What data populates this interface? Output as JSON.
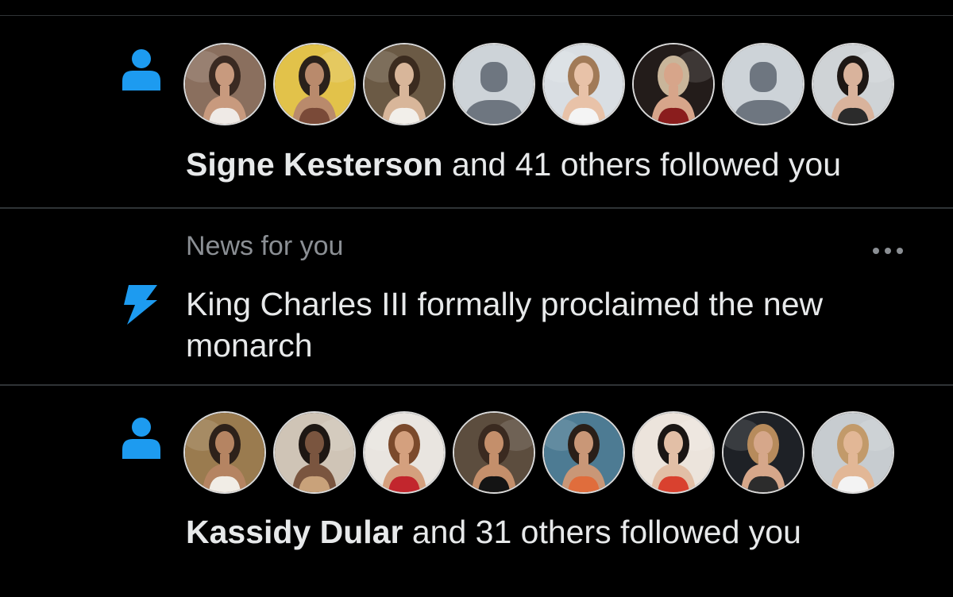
{
  "colors": {
    "background": "#000000",
    "accent": "#1d9bf0",
    "divider": "#2f3336",
    "text_primary": "#e7e9ea",
    "text_secondary": "#8b8f94"
  },
  "notifications": [
    {
      "type": "follow",
      "icon": "person-icon",
      "text": {
        "name": "Signe Kesterson",
        "rest": " and 41 others followed you"
      },
      "avatars": [
        {
          "kind": "photo",
          "bg": "#8a6f5e",
          "skin": "#c89a7e",
          "hair": "#3a2a22",
          "outfit": "#efeae6"
        },
        {
          "kind": "photo",
          "bg": "#e2c24a",
          "skin": "#b98a6c",
          "hair": "#2a211b",
          "outfit": "#7a4a38"
        },
        {
          "kind": "photo",
          "bg": "#6b5a45",
          "skin": "#d8b69a",
          "hair": "#3b2b1f",
          "outfit": "#f2efea"
        },
        {
          "kind": "default"
        },
        {
          "kind": "photo",
          "bg": "#d9dee3",
          "skin": "#e8c2a8",
          "hair": "#a17a57",
          "outfit": "#f4f4f4"
        },
        {
          "kind": "photo",
          "bg": "#231c1a",
          "skin": "#d7a58a",
          "hair": "#c9b59a",
          "outfit": "#8a1d1d"
        },
        {
          "kind": "default"
        },
        {
          "kind": "photo",
          "bg": "#cfd3d6",
          "skin": "#d9b39c",
          "hair": "#1d1714",
          "outfit": "#2b2b2b"
        }
      ]
    },
    {
      "type": "news",
      "icon": "lightning-icon",
      "context": "News for you",
      "headline": "King Charles III formally proclaimed the new monarch",
      "more_icon": "more-dots-icon"
    },
    {
      "type": "follow",
      "icon": "person-icon",
      "text": {
        "name": "Kassidy Dular",
        "rest": " and 31 others followed you"
      },
      "avatars": [
        {
          "kind": "photo",
          "bg": "#9a7b4f",
          "skin": "#b58462",
          "hair": "#2d211a",
          "outfit": "#f1ede6"
        },
        {
          "kind": "photo",
          "bg": "#cfc4b6",
          "skin": "#7a553f",
          "hair": "#1e1713",
          "outfit": "#c9a27a"
        },
        {
          "kind": "photo",
          "bg": "#e9e5e0",
          "skin": "#d4a07e",
          "hair": "#7b4a2c",
          "outfit": "#c2262d"
        },
        {
          "kind": "photo",
          "bg": "#5c4d3e",
          "skin": "#c48f6b",
          "hair": "#3a2a20",
          "outfit": "#141414"
        },
        {
          "kind": "photo",
          "bg": "#4d7b93",
          "skin": "#c99777",
          "hair": "#2a1f18",
          "outfit": "#e06d3c"
        },
        {
          "kind": "photo",
          "bg": "#ece4dc",
          "skin": "#e2bfa6",
          "hair": "#1a1614",
          "outfit": "#d9412f"
        },
        {
          "kind": "photo",
          "bg": "#1e2126",
          "skin": "#d6a78a",
          "hair": "#b78b5c",
          "outfit": "#2c2c2c"
        },
        {
          "kind": "photo",
          "bg": "#c7ccd0",
          "skin": "#e2b796",
          "hair": "#c29a6a",
          "outfit": "#f3f3f3"
        }
      ]
    }
  ]
}
